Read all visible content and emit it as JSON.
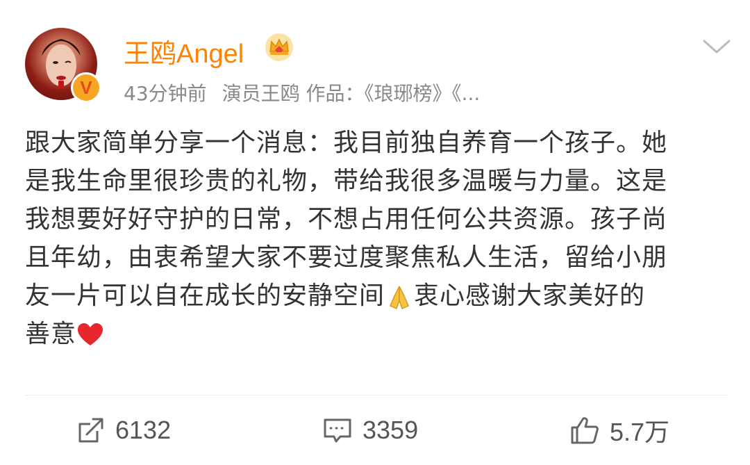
{
  "post": {
    "username": "王鸥Angel",
    "time": "43分钟前",
    "source": "演员王鸥 作品：《琅琊榜》《...",
    "lines": [
      "跟大家简单分享一个消息：我目前独自养育一个孩子。她",
      "是我生命里很珍贵的礼物，带给我很多温暖与力量。这是",
      "我想要好好守护的日常，不想占用任何公共资源。孩子尚",
      "且年幼，由衷希望大家不要过度聚焦私人生活，留给小朋",
      "友一片可以自在成长的安静空间",
      "衷心感谢大家美好的",
      "善意"
    ],
    "icons": {
      "verified_badge": "verified-v-icon",
      "vip": "crown-icon",
      "menu": "chevron-down-icon",
      "emoji1": "folded-hands-icon",
      "emoji2": "red-heart-icon"
    }
  },
  "actions": {
    "repost_count": "6132",
    "comment_count": "3359",
    "like_count": "5.7万"
  },
  "colors": {
    "username": "#ff8200",
    "meta": "#888888",
    "body": "#333333",
    "badge": "#f5a623"
  }
}
